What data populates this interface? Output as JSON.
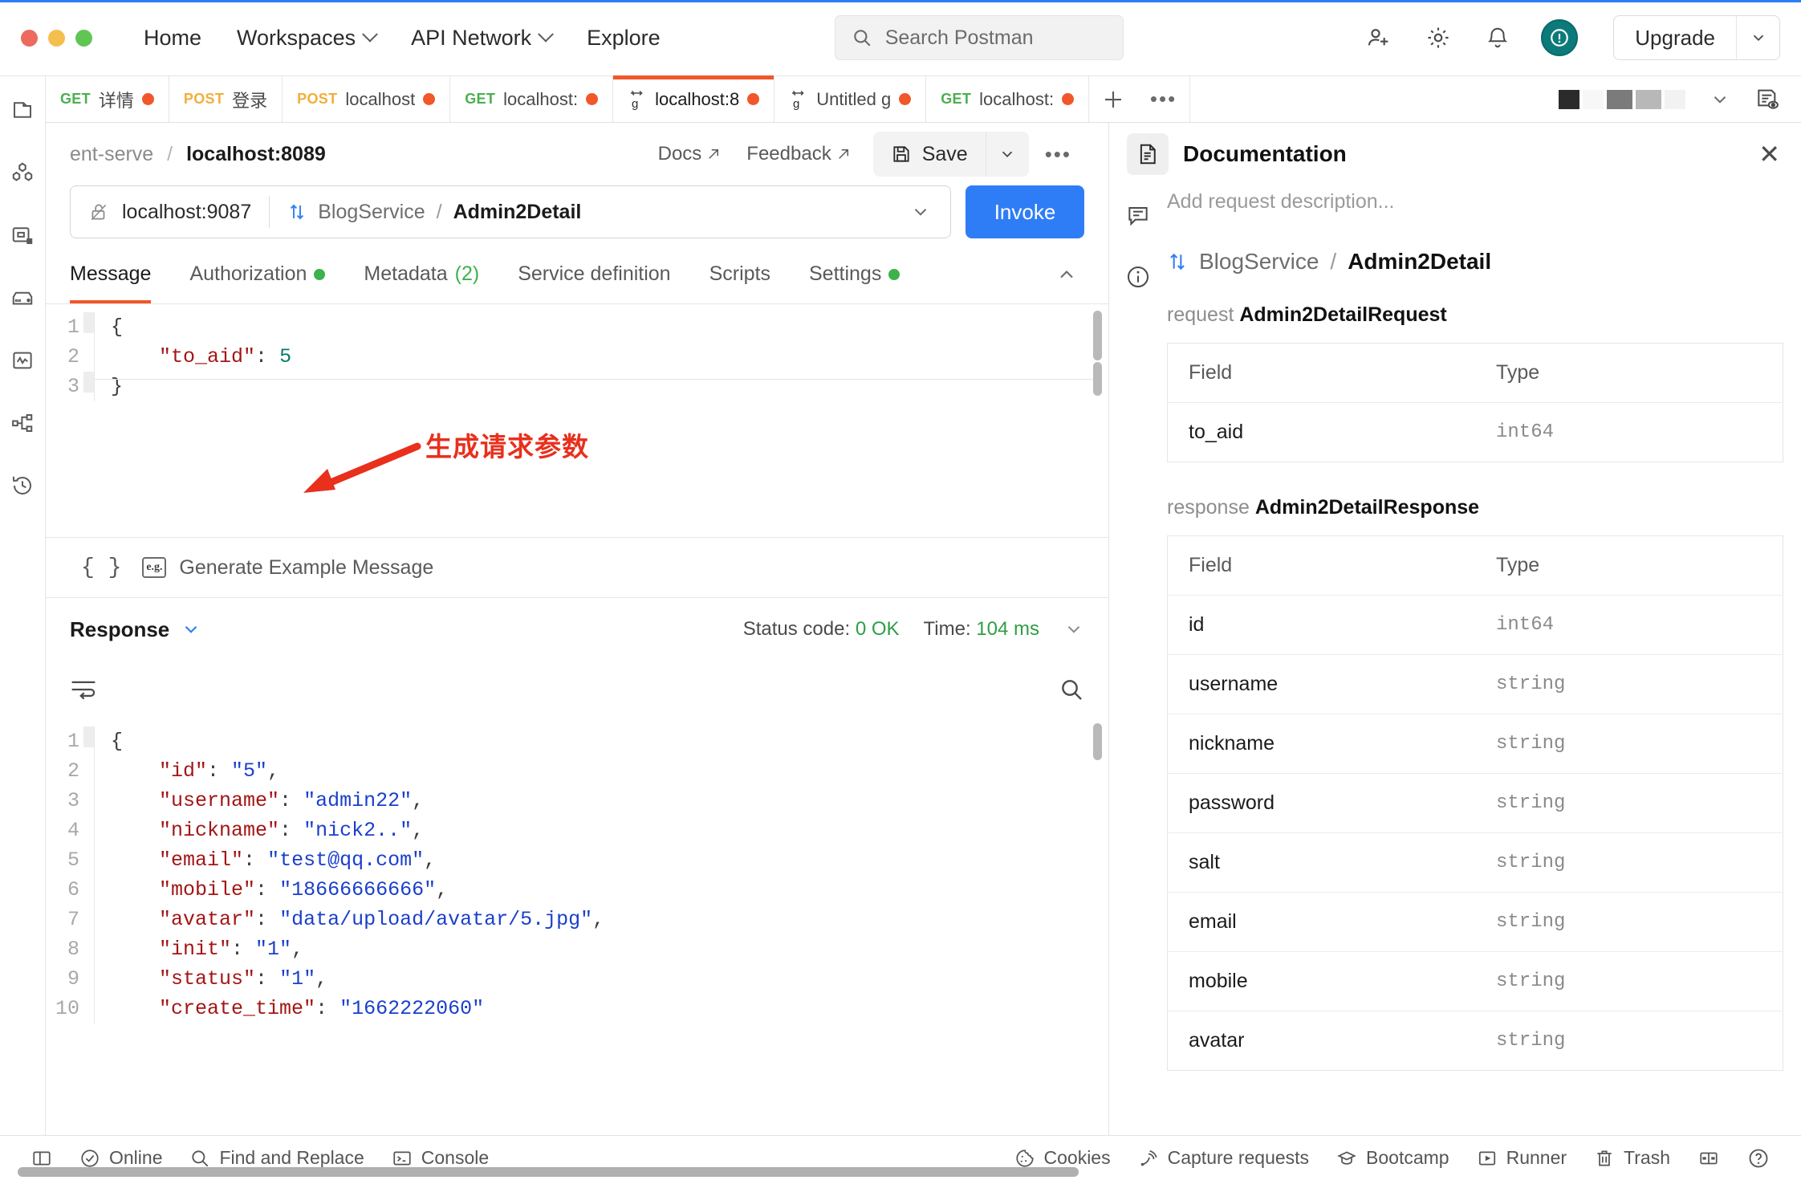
{
  "titlebar": {
    "nav": [
      {
        "label": "Home",
        "caret": false
      },
      {
        "label": "Workspaces",
        "caret": true
      },
      {
        "label": "API Network",
        "caret": true
      },
      {
        "label": "Explore",
        "caret": false
      }
    ],
    "search_placeholder": "Search Postman",
    "upgrade_label": "Upgrade"
  },
  "tabs": [
    {
      "method": "GET",
      "method_class": "get",
      "name": "详情",
      "dirty": true,
      "active": false,
      "grpc": false
    },
    {
      "method": "POST",
      "method_class": "post",
      "name": "登录",
      "dirty": false,
      "active": false,
      "grpc": false
    },
    {
      "method": "POST",
      "method_class": "post",
      "name": "localhost",
      "dirty": true,
      "active": false,
      "grpc": false
    },
    {
      "method": "GET",
      "method_class": "get",
      "name": "localhost:",
      "dirty": true,
      "active": false,
      "grpc": false
    },
    {
      "method": "",
      "method_class": "",
      "name": "localhost:8",
      "dirty": true,
      "active": true,
      "grpc": true
    },
    {
      "method": "",
      "method_class": "",
      "name": "Untitled g",
      "dirty": true,
      "active": false,
      "grpc": true
    },
    {
      "method": "GET",
      "method_class": "get",
      "name": "localhost:",
      "dirty": true,
      "active": false,
      "grpc": false
    }
  ],
  "request": {
    "breadcrumb_collection": "ent-serve",
    "breadcrumb_separator": "/",
    "breadcrumb_name": "localhost:8089",
    "docs_label": "Docs",
    "feedback_label": "Feedback",
    "save_label": "Save",
    "url_host": "localhost:9087",
    "service_name": "BlogService",
    "service_separator": "/",
    "method_name": "Admin2Detail",
    "invoke_label": "Invoke",
    "subtabs": [
      {
        "label": "Message",
        "active": true,
        "dot": false,
        "count": ""
      },
      {
        "label": "Authorization",
        "active": false,
        "dot": true,
        "count": ""
      },
      {
        "label": "Metadata",
        "active": false,
        "dot": false,
        "count": "(2)"
      },
      {
        "label": "Service definition",
        "active": false,
        "dot": false,
        "count": ""
      },
      {
        "label": "Scripts",
        "active": false,
        "dot": false,
        "count": ""
      },
      {
        "label": "Settings",
        "active": false,
        "dot": true,
        "count": ""
      }
    ],
    "message_body": {
      "lines": [
        {
          "n": "1",
          "segments": [
            {
              "t": "{",
              "c": "pun"
            }
          ]
        },
        {
          "n": "2",
          "segments": [
            {
              "t": "    ",
              "c": "pun"
            },
            {
              "t": "\"to_aid\"",
              "c": "k"
            },
            {
              "t": ": ",
              "c": "pun"
            },
            {
              "t": "5",
              "c": "num"
            }
          ]
        },
        {
          "n": "3",
          "segments": [
            {
              "t": "}",
              "c": "pun"
            }
          ]
        }
      ]
    },
    "generate_label": "Generate Example Message",
    "generate_icon_text": "e.g.",
    "braces_label": "{ }"
  },
  "annotation": {
    "text": "生成请求参数",
    "color": "#e8301d"
  },
  "response": {
    "title": "Response",
    "status_label": "Status code:",
    "status_value": "0 OK",
    "time_label": "Time:",
    "time_value": "104 ms",
    "body": {
      "lines": [
        {
          "n": "1",
          "segments": [
            {
              "t": "{",
              "c": "pun"
            }
          ]
        },
        {
          "n": "2",
          "segments": [
            {
              "t": "    ",
              "c": "pun"
            },
            {
              "t": "\"id\"",
              "c": "k"
            },
            {
              "t": ": ",
              "c": "pun"
            },
            {
              "t": "\"5\"",
              "c": "str"
            },
            {
              "t": ",",
              "c": "pun"
            }
          ]
        },
        {
          "n": "3",
          "segments": [
            {
              "t": "    ",
              "c": "pun"
            },
            {
              "t": "\"username\"",
              "c": "k"
            },
            {
              "t": ": ",
              "c": "pun"
            },
            {
              "t": "\"admin22\"",
              "c": "str"
            },
            {
              "t": ",",
              "c": "pun"
            }
          ]
        },
        {
          "n": "4",
          "segments": [
            {
              "t": "    ",
              "c": "pun"
            },
            {
              "t": "\"nickname\"",
              "c": "k"
            },
            {
              "t": ": ",
              "c": "pun"
            },
            {
              "t": "\"nick2..\"",
              "c": "str"
            },
            {
              "t": ",",
              "c": "pun"
            }
          ]
        },
        {
          "n": "5",
          "segments": [
            {
              "t": "    ",
              "c": "pun"
            },
            {
              "t": "\"email\"",
              "c": "k"
            },
            {
              "t": ": ",
              "c": "pun"
            },
            {
              "t": "\"test@qq.com\"",
              "c": "str"
            },
            {
              "t": ",",
              "c": "pun"
            }
          ]
        },
        {
          "n": "6",
          "segments": [
            {
              "t": "    ",
              "c": "pun"
            },
            {
              "t": "\"mobile\"",
              "c": "k"
            },
            {
              "t": ": ",
              "c": "pun"
            },
            {
              "t": "\"18666666666\"",
              "c": "str"
            },
            {
              "t": ",",
              "c": "pun"
            }
          ]
        },
        {
          "n": "7",
          "segments": [
            {
              "t": "    ",
              "c": "pun"
            },
            {
              "t": "\"avatar\"",
              "c": "k"
            },
            {
              "t": ": ",
              "c": "pun"
            },
            {
              "t": "\"data/upload/avatar/5.jpg\"",
              "c": "str"
            },
            {
              "t": ",",
              "c": "pun"
            }
          ]
        },
        {
          "n": "8",
          "segments": [
            {
              "t": "    ",
              "c": "pun"
            },
            {
              "t": "\"init\"",
              "c": "k"
            },
            {
              "t": ": ",
              "c": "pun"
            },
            {
              "t": "\"1\"",
              "c": "str"
            },
            {
              "t": ",",
              "c": "pun"
            }
          ]
        },
        {
          "n": "9",
          "segments": [
            {
              "t": "    ",
              "c": "pun"
            },
            {
              "t": "\"status\"",
              "c": "k"
            },
            {
              "t": ": ",
              "c": "pun"
            },
            {
              "t": "\"1\"",
              "c": "str"
            },
            {
              "t": ",",
              "c": "pun"
            }
          ]
        },
        {
          "n": "10",
          "segments": [
            {
              "t": "    ",
              "c": "pun"
            },
            {
              "t": "\"create_time\"",
              "c": "k"
            },
            {
              "t": ": ",
              "c": "pun"
            },
            {
              "t": "\"1662222060\"",
              "c": "str"
            }
          ]
        }
      ]
    }
  },
  "documentation": {
    "title": "Documentation",
    "description_placeholder": "Add request description...",
    "service_name": "BlogService",
    "service_separator": "/",
    "method_name": "Admin2Detail",
    "request_section_label": "request",
    "request_type_name": "Admin2DetailRequest",
    "response_section_label": "response",
    "response_type_name": "Admin2DetailResponse",
    "columns": [
      "Field",
      "Type"
    ],
    "request_fields": [
      {
        "field": "to_aid",
        "type": "int64"
      }
    ],
    "response_fields": [
      {
        "field": "id",
        "type": "int64"
      },
      {
        "field": "username",
        "type": "string"
      },
      {
        "field": "nickname",
        "type": "string"
      },
      {
        "field": "password",
        "type": "string"
      },
      {
        "field": "salt",
        "type": "string"
      },
      {
        "field": "email",
        "type": "string"
      },
      {
        "field": "mobile",
        "type": "string"
      },
      {
        "field": "avatar",
        "type": "string"
      }
    ]
  },
  "statusbar": {
    "left": [
      {
        "label": "Online",
        "icon": "check-circle-icon"
      },
      {
        "label": "Find and Replace",
        "icon": "search-icon"
      },
      {
        "label": "Console",
        "icon": "console-icon"
      }
    ],
    "right": [
      {
        "label": "Cookies",
        "icon": "cookie-icon"
      },
      {
        "label": "Capture requests",
        "icon": "satellite-icon"
      },
      {
        "label": "Bootcamp",
        "icon": "graduation-cap-icon"
      },
      {
        "label": "Runner",
        "icon": "play-icon"
      },
      {
        "label": "Trash",
        "icon": "trash-icon"
      }
    ]
  },
  "colors": {
    "accent_orange": "#f1572a",
    "invoke_blue": "#2f7df6",
    "success_green": "#2e9e44",
    "annotation_red": "#e8301d"
  }
}
